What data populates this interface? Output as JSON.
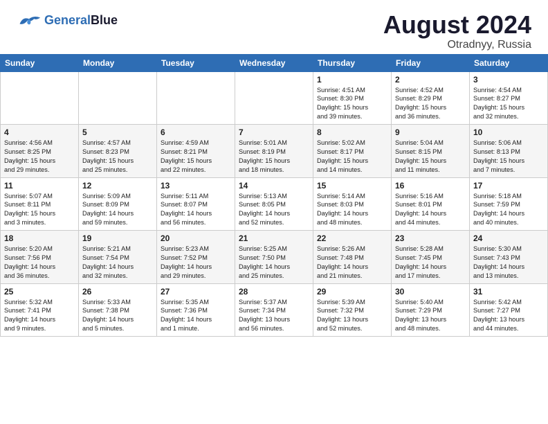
{
  "header": {
    "logo_line1": "General",
    "logo_line2": "Blue",
    "month_title": "August 2024",
    "location": "Otradnyy, Russia"
  },
  "weekdays": [
    "Sunday",
    "Monday",
    "Tuesday",
    "Wednesday",
    "Thursday",
    "Friday",
    "Saturday"
  ],
  "rows": [
    {
      "cells": [
        {
          "day": "",
          "content": ""
        },
        {
          "day": "",
          "content": ""
        },
        {
          "day": "",
          "content": ""
        },
        {
          "day": "",
          "content": ""
        },
        {
          "day": "1",
          "content": "Sunrise: 4:51 AM\nSunset: 8:30 PM\nDaylight: 15 hours\nand 39 minutes."
        },
        {
          "day": "2",
          "content": "Sunrise: 4:52 AM\nSunset: 8:29 PM\nDaylight: 15 hours\nand 36 minutes."
        },
        {
          "day": "3",
          "content": "Sunrise: 4:54 AM\nSunset: 8:27 PM\nDaylight: 15 hours\nand 32 minutes."
        }
      ]
    },
    {
      "cells": [
        {
          "day": "4",
          "content": "Sunrise: 4:56 AM\nSunset: 8:25 PM\nDaylight: 15 hours\nand 29 minutes."
        },
        {
          "day": "5",
          "content": "Sunrise: 4:57 AM\nSunset: 8:23 PM\nDaylight: 15 hours\nand 25 minutes."
        },
        {
          "day": "6",
          "content": "Sunrise: 4:59 AM\nSunset: 8:21 PM\nDaylight: 15 hours\nand 22 minutes."
        },
        {
          "day": "7",
          "content": "Sunrise: 5:01 AM\nSunset: 8:19 PM\nDaylight: 15 hours\nand 18 minutes."
        },
        {
          "day": "8",
          "content": "Sunrise: 5:02 AM\nSunset: 8:17 PM\nDaylight: 15 hours\nand 14 minutes."
        },
        {
          "day": "9",
          "content": "Sunrise: 5:04 AM\nSunset: 8:15 PM\nDaylight: 15 hours\nand 11 minutes."
        },
        {
          "day": "10",
          "content": "Sunrise: 5:06 AM\nSunset: 8:13 PM\nDaylight: 15 hours\nand 7 minutes."
        }
      ]
    },
    {
      "cells": [
        {
          "day": "11",
          "content": "Sunrise: 5:07 AM\nSunset: 8:11 PM\nDaylight: 15 hours\nand 3 minutes."
        },
        {
          "day": "12",
          "content": "Sunrise: 5:09 AM\nSunset: 8:09 PM\nDaylight: 14 hours\nand 59 minutes."
        },
        {
          "day": "13",
          "content": "Sunrise: 5:11 AM\nSunset: 8:07 PM\nDaylight: 14 hours\nand 56 minutes."
        },
        {
          "day": "14",
          "content": "Sunrise: 5:13 AM\nSunset: 8:05 PM\nDaylight: 14 hours\nand 52 minutes."
        },
        {
          "day": "15",
          "content": "Sunrise: 5:14 AM\nSunset: 8:03 PM\nDaylight: 14 hours\nand 48 minutes."
        },
        {
          "day": "16",
          "content": "Sunrise: 5:16 AM\nSunset: 8:01 PM\nDaylight: 14 hours\nand 44 minutes."
        },
        {
          "day": "17",
          "content": "Sunrise: 5:18 AM\nSunset: 7:59 PM\nDaylight: 14 hours\nand 40 minutes."
        }
      ]
    },
    {
      "cells": [
        {
          "day": "18",
          "content": "Sunrise: 5:20 AM\nSunset: 7:56 PM\nDaylight: 14 hours\nand 36 minutes."
        },
        {
          "day": "19",
          "content": "Sunrise: 5:21 AM\nSunset: 7:54 PM\nDaylight: 14 hours\nand 32 minutes."
        },
        {
          "day": "20",
          "content": "Sunrise: 5:23 AM\nSunset: 7:52 PM\nDaylight: 14 hours\nand 29 minutes."
        },
        {
          "day": "21",
          "content": "Sunrise: 5:25 AM\nSunset: 7:50 PM\nDaylight: 14 hours\nand 25 minutes."
        },
        {
          "day": "22",
          "content": "Sunrise: 5:26 AM\nSunset: 7:48 PM\nDaylight: 14 hours\nand 21 minutes."
        },
        {
          "day": "23",
          "content": "Sunrise: 5:28 AM\nSunset: 7:45 PM\nDaylight: 14 hours\nand 17 minutes."
        },
        {
          "day": "24",
          "content": "Sunrise: 5:30 AM\nSunset: 7:43 PM\nDaylight: 14 hours\nand 13 minutes."
        }
      ]
    },
    {
      "cells": [
        {
          "day": "25",
          "content": "Sunrise: 5:32 AM\nSunset: 7:41 PM\nDaylight: 14 hours\nand 9 minutes."
        },
        {
          "day": "26",
          "content": "Sunrise: 5:33 AM\nSunset: 7:38 PM\nDaylight: 14 hours\nand 5 minutes."
        },
        {
          "day": "27",
          "content": "Sunrise: 5:35 AM\nSunset: 7:36 PM\nDaylight: 14 hours\nand 1 minute."
        },
        {
          "day": "28",
          "content": "Sunrise: 5:37 AM\nSunset: 7:34 PM\nDaylight: 13 hours\nand 56 minutes."
        },
        {
          "day": "29",
          "content": "Sunrise: 5:39 AM\nSunset: 7:32 PM\nDaylight: 13 hours\nand 52 minutes."
        },
        {
          "day": "30",
          "content": "Sunrise: 5:40 AM\nSunset: 7:29 PM\nDaylight: 13 hours\nand 48 minutes."
        },
        {
          "day": "31",
          "content": "Sunrise: 5:42 AM\nSunset: 7:27 PM\nDaylight: 13 hours\nand 44 minutes."
        }
      ]
    }
  ]
}
